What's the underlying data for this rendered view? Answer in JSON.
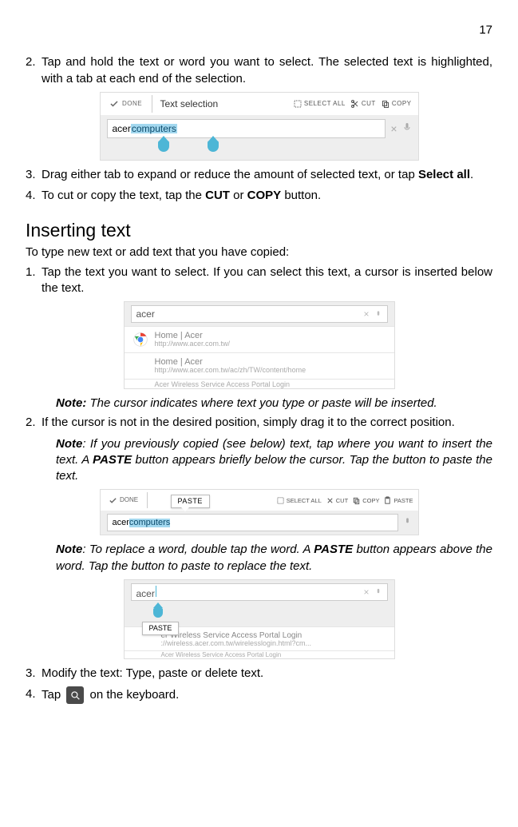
{
  "page_number": "17",
  "selecting": {
    "item2": "Tap and hold the text or word you want to select. The selected text is highlighted, with a tab at each end of the selection.",
    "item3_a": "Drag either tab to expand or reduce the amount of selected text, or tap ",
    "item3_b": "Select all",
    "item3_c": ".",
    "item4_a": "To cut or copy the text, tap the ",
    "item4_b": "CUT",
    "item4_c": " or ",
    "item4_d": "COPY",
    "item4_e": " button."
  },
  "fig1": {
    "done": "DONE",
    "title": "Text selection",
    "select_all": "SELECT ALL",
    "cut": "CUT",
    "copy": "COPY",
    "input_prefix": "acer ",
    "input_sel": "computers"
  },
  "inserting": {
    "heading": "Inserting text",
    "intro": "To type new text or add text that you have copied:",
    "item1": "Tap the text you want to select. If you can select this text, a cursor is inserted below the text.",
    "note1_label": "Note:",
    "note1_body": " The cursor indicates where text you type or paste will be inserted.",
    "item2": "If the cursor is not in the desired position, simply drag it to the correct position.",
    "note2_label": "Note",
    "note2_body_a": ": If you previously copied (see below) text, tap where you want to insert the text. A ",
    "note2_body_b": "PASTE",
    "note2_body_c": " button appears briefly below the cursor. Tap the button to paste the text.",
    "note3_label": "Note",
    "note3_body_a": ": To replace a word, double tap the word. A ",
    "note3_body_b": "PASTE",
    "note3_body_c": " button appears above the word. Tap the button to paste to replace the text.",
    "item3": "Modify the text: Type, paste or delete text.",
    "item4_a": "Tap ",
    "item4_b": " on the keyboard."
  },
  "fig2": {
    "input": "acer",
    "row1_title": "Home | Acer",
    "row1_url": "http://www.acer.com.tw/",
    "row2_title": "Home | Acer",
    "row2_url": "http://www.acer.com.tw/ac/zh/TW/content/home",
    "row3_partial": "Acer Wireless Service Access Portal Login"
  },
  "fig3": {
    "done": "DONE",
    "paste_btn": "PASTE",
    "select_all": "SELECT ALL",
    "cut": "CUT",
    "copy": "COPY",
    "paste": "PASTE",
    "input_prefix": "acer ",
    "input_sel": "computers"
  },
  "fig4": {
    "input": "acer",
    "paste_btn": "PASTE",
    "row1_title": "er Wireless Service Access Portal Login",
    "row1_url": "://wireless.acer.com.tw/wirelesslogin.html?cm...",
    "row2_partial": "Acer Wireless Service Access Portal Login"
  }
}
